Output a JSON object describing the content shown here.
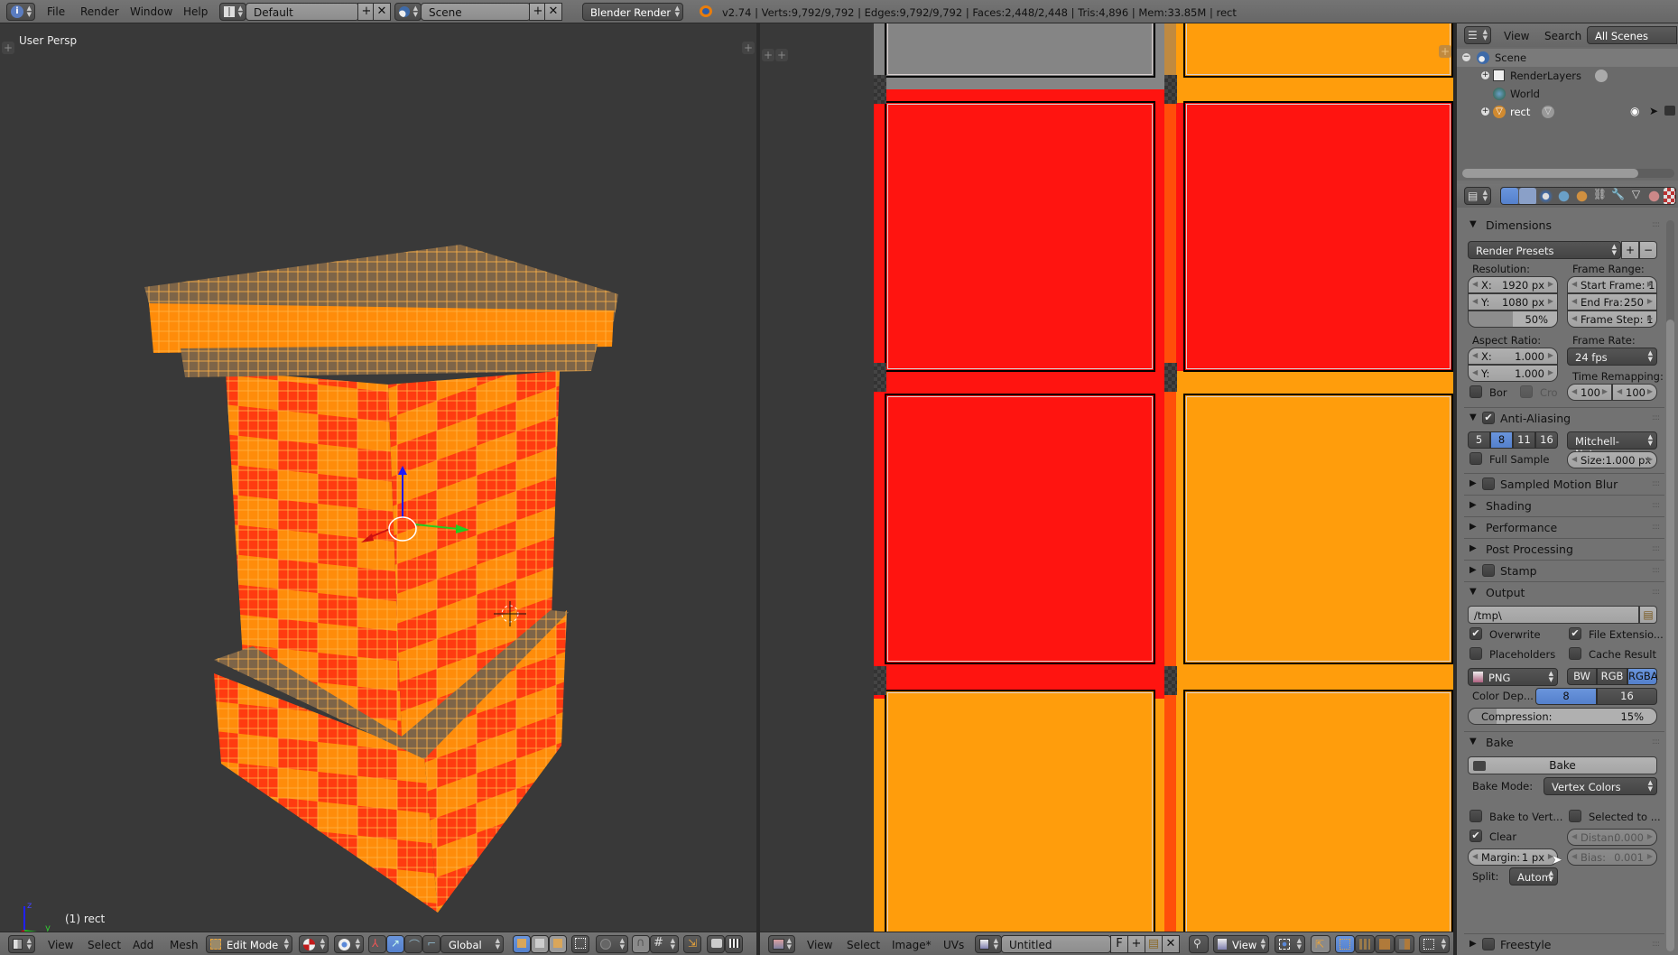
{
  "topbar": {
    "menus": [
      "File",
      "Render",
      "Window",
      "Help"
    ],
    "screen_layout": "Default",
    "scene": "Scene",
    "render_engine": "Blender Render",
    "info": "v2.74 | Verts:9,792/9,792 | Edges:9,792/9,792 | Faces:2,448/2,448 | Tris:4,896 | Mem:33.85M | rect"
  },
  "view3d": {
    "view_label": "User Persp",
    "object_label": "(1) rect",
    "axis_labels": {
      "z": "z",
      "y": "y"
    },
    "header": {
      "menus": [
        "View",
        "Select",
        "Add",
        "Mesh"
      ],
      "mode": "Edit Mode",
      "orientation": "Global"
    }
  },
  "uv_editor": {
    "header": {
      "menus": [
        "View",
        "Select",
        "Image*",
        "UVs"
      ],
      "image_name": "Untitled",
      "fake_user": "F",
      "view_mode": "View"
    },
    "colors": {
      "red": "#ff1410",
      "orange": "#ff9d0c",
      "grey": "#858585",
      "dark": "#393939"
    }
  },
  "outliner": {
    "menus": [
      "View",
      "Search"
    ],
    "display_mode": "All Scenes",
    "tree": [
      {
        "label": "Scene",
        "level": 0
      },
      {
        "label": "RenderLayers",
        "level": 1
      },
      {
        "label": "World",
        "level": 1
      },
      {
        "label": "rect",
        "level": 1
      }
    ]
  },
  "properties": {
    "dimensions": {
      "title": "Dimensions",
      "render_presets": "Render Presets",
      "resolution_label": "Resolution:",
      "res_x_label": "X:",
      "res_x": "1920 px",
      "res_y_label": "Y:",
      "res_y": "1080 px",
      "res_percent": "50%",
      "res_percent_fraction": 0.5,
      "frame_range_label": "Frame Range:",
      "start_frame": "Start Frame: 1",
      "end_frame_label": "End Fra:",
      "end_frame": "250",
      "frame_step": "Frame Step: 1",
      "aspect_label": "Aspect Ratio:",
      "aspect_x_label": "X:",
      "aspect_x": "1.000",
      "aspect_y_label": "Y:",
      "aspect_y": "1.000",
      "frame_rate_label": "Frame Rate:",
      "frame_rate": "24 fps",
      "time_remap_label": "Time Remapping:",
      "time_old": "100",
      "time_new": "100",
      "border_label": "Bor",
      "crop_label": "Cro"
    },
    "anti_aliasing": {
      "title": "Anti-Aliasing",
      "enabled": true,
      "samples": [
        "5",
        "8",
        "11",
        "16"
      ],
      "selected": "8",
      "filter": "Mitchell-Netra...",
      "full_sample_label": "Full Sample",
      "size": "Size:1.000 px"
    },
    "collapsed_panels": [
      {
        "title": "Sampled Motion Blur",
        "checkbox": true
      },
      {
        "title": "Shading",
        "checkbox": false
      },
      {
        "title": "Performance",
        "checkbox": false
      },
      {
        "title": "Post Processing",
        "checkbox": false
      },
      {
        "title": "Stamp",
        "checkbox": true
      }
    ],
    "output": {
      "title": "Output",
      "path": "/tmp\\",
      "overwrite_label": "Overwrite",
      "overwrite": true,
      "file_ext_label": "File Extensio...",
      "file_ext": true,
      "placeholders_label": "Placeholders",
      "placeholders": false,
      "cache_label": "Cache Result",
      "cache": false,
      "format": "PNG",
      "color_modes": [
        "BW",
        "RGB",
        "RGBA"
      ],
      "color_mode_selected": "RGBA",
      "color_depth_label": "Color Dep...",
      "color_depths": [
        "8",
        "16"
      ],
      "color_depth_selected": "8",
      "compression_label": "Compression:",
      "compression": "15%",
      "compression_fraction": 0.15
    },
    "bake": {
      "title": "Bake",
      "bake_button": "Bake",
      "mode_label": "Bake Mode:",
      "mode": "Vertex Colors",
      "bake_to_vert_label": "Bake to Vert...",
      "selected_to_label": "Selected to ...",
      "clear_label": "Clear",
      "clear": true,
      "distance_label": "Distan:",
      "distance": "0.000",
      "margin_label": "Margin:",
      "margin": "1 px",
      "bias_label": "Bias:",
      "bias": "0.001",
      "split_label": "Split:",
      "split": "Autom"
    },
    "freestyle": {
      "title": "Freestyle"
    }
  }
}
